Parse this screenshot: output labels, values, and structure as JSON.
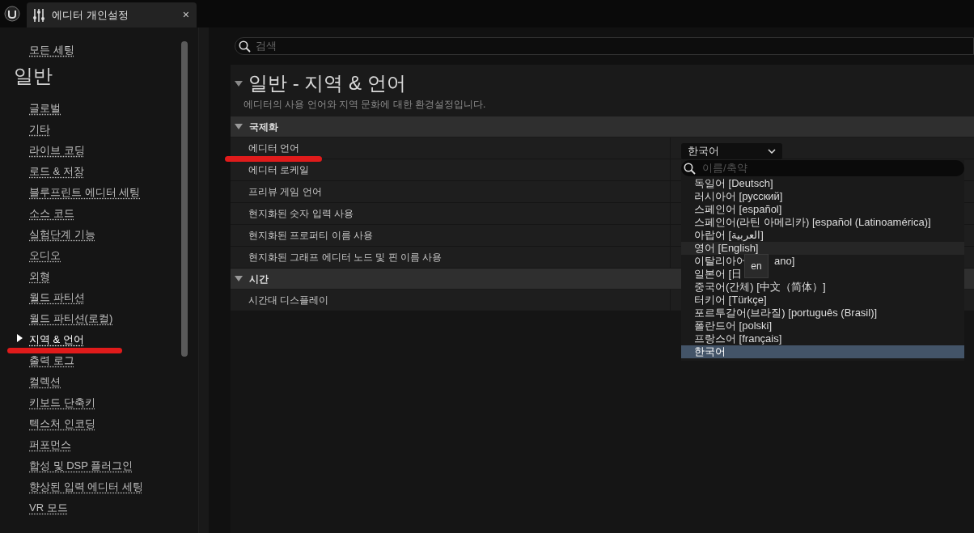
{
  "tab": {
    "title": "에디터 개인설정",
    "close": "×"
  },
  "sidebar": {
    "all_settings": "모든 세팅",
    "sections": [
      {
        "heading": "일반",
        "items": [
          {
            "label": "글로벌",
            "selected": false
          },
          {
            "label": "기타",
            "selected": false
          },
          {
            "label": "라이브 코딩",
            "selected": false
          },
          {
            "label": "로드 & 저장",
            "selected": false
          },
          {
            "label": "블루프린트 에디터 세팅",
            "selected": false
          },
          {
            "label": "소스 코드",
            "selected": false
          },
          {
            "label": "실험단계 기능",
            "selected": false
          },
          {
            "label": "오디오",
            "selected": false
          },
          {
            "label": "외형",
            "selected": false
          },
          {
            "label": "월드 파티션",
            "selected": false
          },
          {
            "label": "월드 파티션(로컬)",
            "selected": false
          },
          {
            "label": "지역 & 언어",
            "selected": true
          },
          {
            "label": "출력 로그",
            "selected": false
          },
          {
            "label": "컬렉션",
            "selected": false
          },
          {
            "label": "키보드 단축키",
            "selected": false
          },
          {
            "label": "텍스처 인코딩",
            "selected": false
          },
          {
            "label": "퍼포먼스",
            "selected": false
          },
          {
            "label": "합성 및 DSP 플러그인",
            "selected": false
          },
          {
            "label": "향상된 입력 에디터 세팅",
            "selected": false
          },
          {
            "label": "VR 모드",
            "selected": false
          }
        ]
      }
    ]
  },
  "search": {
    "placeholder": "검색"
  },
  "page": {
    "title": "일반 - 지역 & 언어",
    "description": "에디터의 사용 언어와 지역 문화에 대한 환경설정입니다."
  },
  "categories": [
    {
      "name": "국제화",
      "expanded": true,
      "rows": [
        "에디터 언어",
        "에디터 로케일",
        "프리뷰 게임 언어",
        "현지화된 숫자 입력 사용",
        "현지화된 프로퍼티 이름 사용",
        "현지화된 그래프 에디터 노드 및 핀 이름 사용"
      ]
    },
    {
      "name": "시간",
      "expanded": true,
      "rows": [
        "시간대 디스플레이"
      ]
    }
  ],
  "combo": {
    "value": "한국어"
  },
  "dropdown": {
    "placeholder": "이름/축약",
    "items": [
      {
        "parts": [
          "독일어 [Deutsch]"
        ],
        "hovered": false,
        "selected": false
      },
      {
        "parts": [
          "러시아어 [русский]"
        ],
        "hovered": false,
        "selected": false
      },
      {
        "parts": [
          "스페인어 [español]"
        ],
        "hovered": false,
        "selected": false
      },
      {
        "parts": [
          "스페인어(라틴 아메리카) [español (Latinoamérica)]"
        ],
        "hovered": false,
        "selected": false
      },
      {
        "parts": [
          "아랍어 [العربية]"
        ],
        "hovered": false,
        "selected": false
      },
      {
        "parts": [
          "영어 [English]"
        ],
        "hovered": true,
        "selected": false
      },
      {
        "parts": [
          "이탈리아어",
          "ano]"
        ],
        "hovered": false,
        "selected": false
      },
      {
        "parts": [
          "일본어 [日"
        ],
        "hovered": false,
        "selected": false
      },
      {
        "parts": [
          "중국어(간체) [中文（简体）]"
        ],
        "hovered": false,
        "selected": false
      },
      {
        "parts": [
          "터키어 [Türkçe]"
        ],
        "hovered": false,
        "selected": false
      },
      {
        "parts": [
          "포르투갈어(브라질) [português (Brasil)]"
        ],
        "hovered": false,
        "selected": false
      },
      {
        "parts": [
          "폴란드어 [polski]"
        ],
        "hovered": false,
        "selected": false
      },
      {
        "parts": [
          "프랑스어 [français]"
        ],
        "hovered": false,
        "selected": false
      },
      {
        "parts": [
          "한국어"
        ],
        "hovered": false,
        "selected": true
      }
    ],
    "tooltip": "en"
  }
}
